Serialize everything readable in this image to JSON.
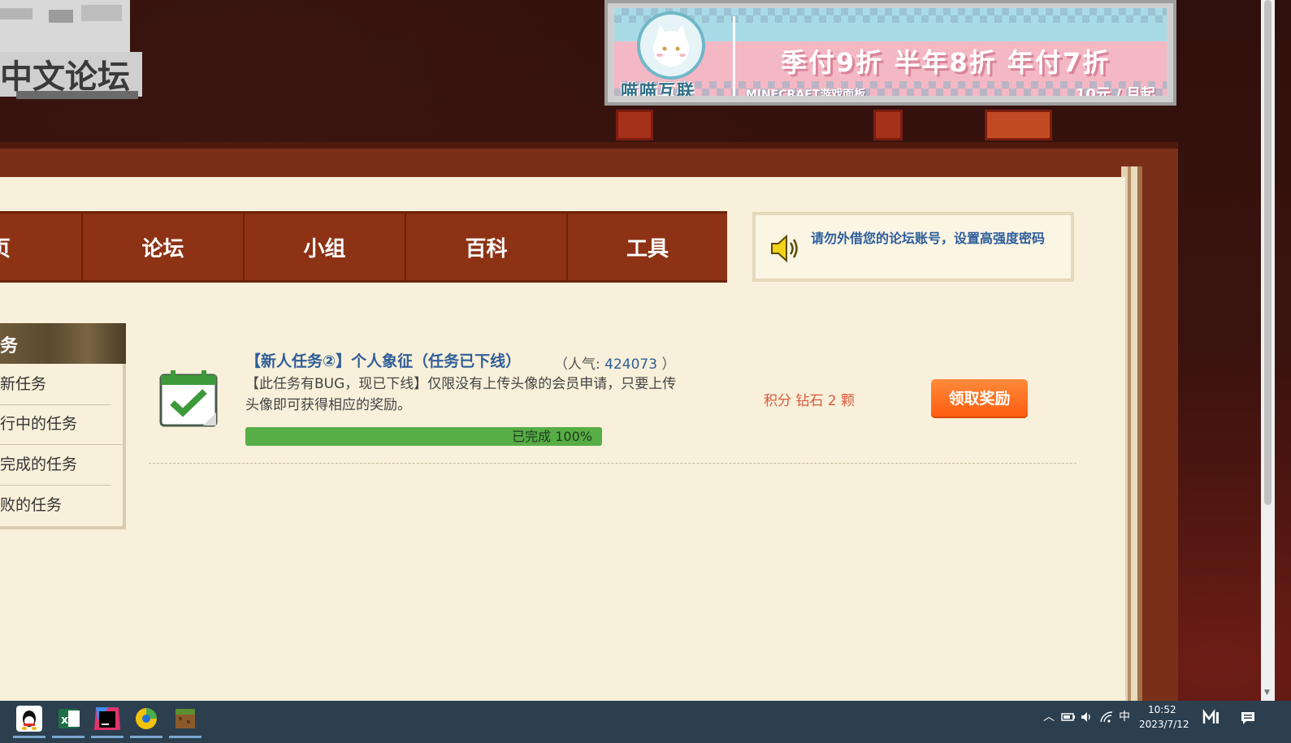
{
  "logo": {
    "text": "中文论坛"
  },
  "banner": {
    "brand": "喵喵互联",
    "promo": "季付9折 半年8折 年付7折",
    "sub": "MINECRAFT游戏面板",
    "price": "10元 / 月起"
  },
  "nav": {
    "items": [
      {
        "label": "页"
      },
      {
        "label": "论坛"
      },
      {
        "label": "小组"
      },
      {
        "label": "百科"
      },
      {
        "label": "工具"
      }
    ]
  },
  "notice": {
    "text": "请勿外借您的论坛账号，设置高强度密码"
  },
  "sidebar": {
    "title": "务",
    "items": [
      {
        "label": "新任务"
      },
      {
        "label": "行中的任务"
      },
      {
        "label": "完成的任务"
      },
      {
        "label": "败的任务"
      }
    ]
  },
  "task": {
    "title": "【新人任务②】个人象征（任务已下线）",
    "popularity_prefix": "（人气:",
    "popularity": "424073",
    "popularity_suffix": "）",
    "description": "【此任务有BUG，现已下线】仅限没有上传头像的会员申请，只要上传头像即可获得相应的奖励。",
    "progress_label": "已完成 100%",
    "progress_fraction": 1.0,
    "reward": "积分 钻石 2 颗",
    "claim_label": "领取奖励"
  },
  "taskbar": {
    "apps": [
      {
        "icon": "qq-icon",
        "color": "#ffffff"
      },
      {
        "icon": "excel-icon",
        "color": "#1d7044"
      },
      {
        "icon": "intellij-icon",
        "color": "#e0336c"
      },
      {
        "icon": "chrome-like-icon",
        "color": "#f4c20d"
      },
      {
        "icon": "minecraft-icon",
        "color": "#8b5a2b"
      }
    ],
    "ime": "中",
    "time": "10:52",
    "date": "2023/7/12"
  },
  "colors": {
    "nav_bg": "#8d3214",
    "page_bg": "#f8f0da",
    "link_blue": "#2f5e98",
    "progress_green": "#57ad46",
    "button_orange": "#ff6a1a",
    "reward_red": "#d75a3c"
  }
}
